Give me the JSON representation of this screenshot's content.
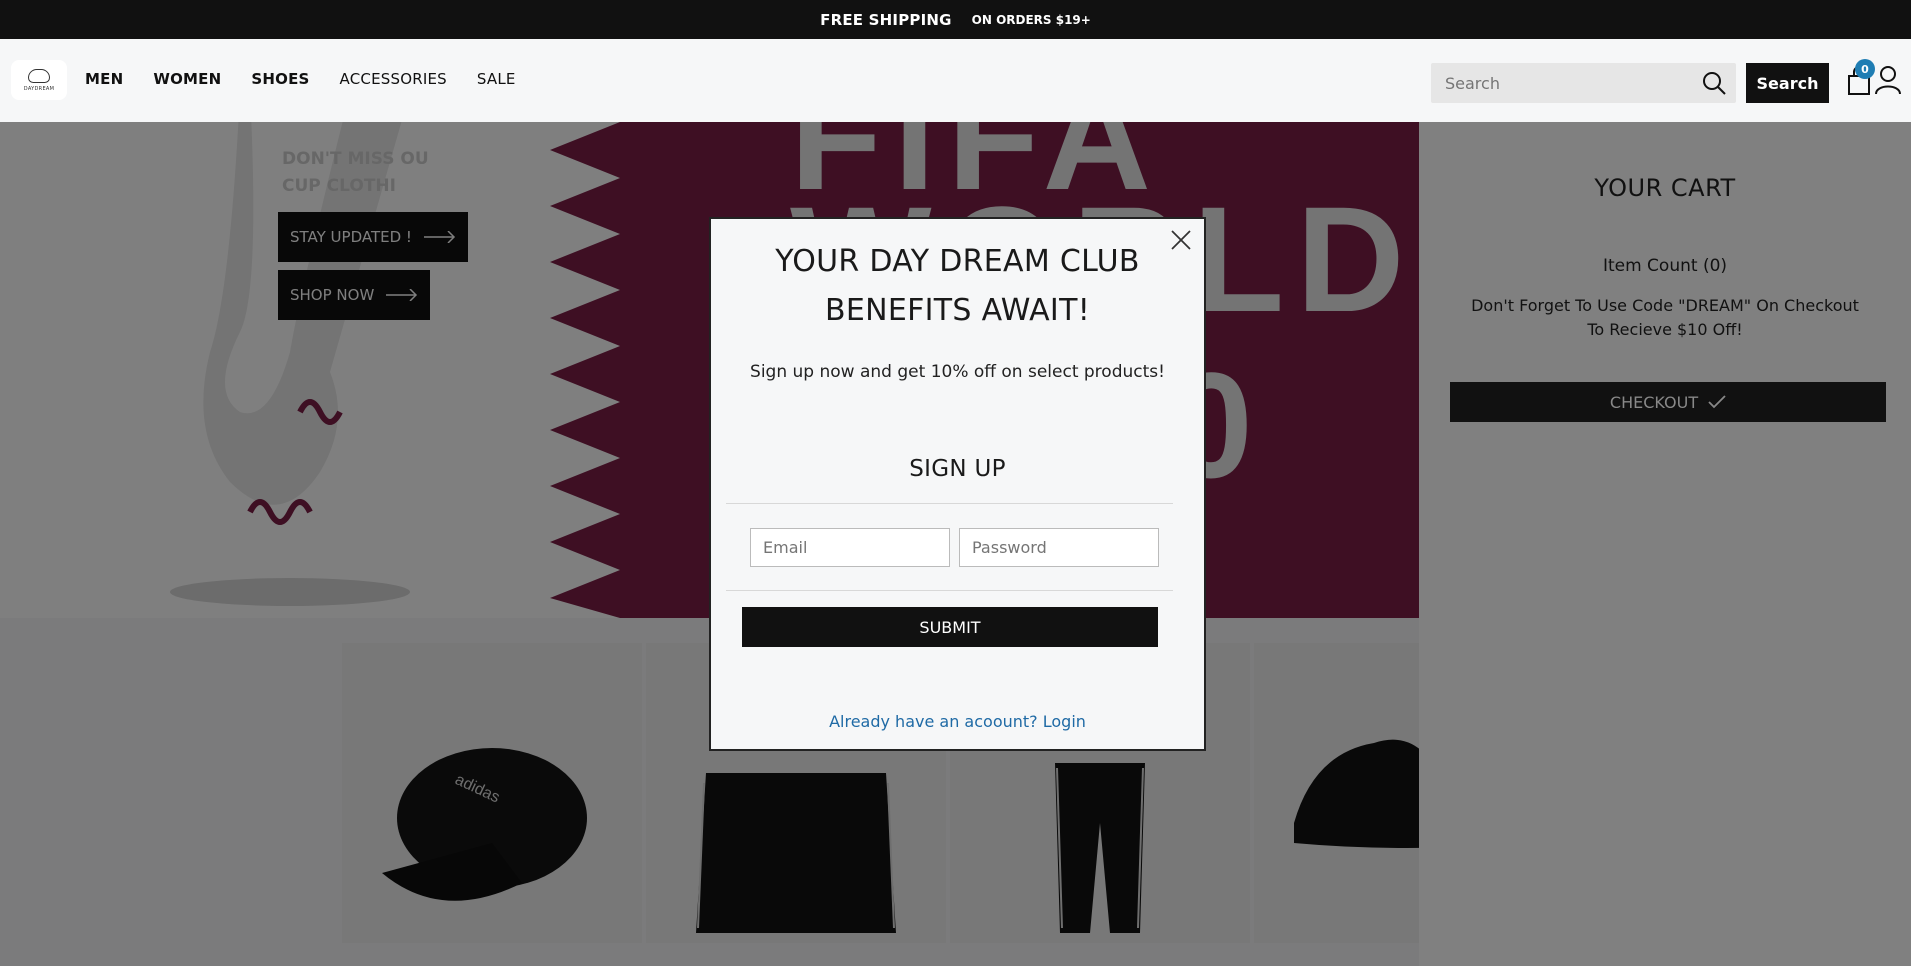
{
  "banner": {
    "bold": "FREE SHIPPING",
    "light": "ON ORDERS $19+"
  },
  "header": {
    "logo_text": "DAYDREAM",
    "nav": [
      "MEN",
      "WOMEN",
      "SHOES",
      "ACCESSORIES",
      "SALE"
    ],
    "search_placeholder": "Search",
    "search_button": "Search",
    "cart_badge": "0"
  },
  "hero": {
    "text_line1": "DON'T MISS OU",
    "text_line2": "CUP CLOTHI",
    "btn_stay": "STAY UPDATED !",
    "btn_shop": "SHOP NOW",
    "big_row1": "FIFA",
    "big_row2": "WORLD C",
    "big_row3": "R 20"
  },
  "cart": {
    "title": "YOUR CART",
    "item_count": "Item Count (0)",
    "promo": "Don't Forget To Use Code \"DREAM\" On Checkout To Recieve $10 Off!",
    "checkout": "CHECKOUT"
  },
  "modal": {
    "heading_line1": "YOUR DAY DREAM CLUB",
    "heading_line2": "BENEFITS AWAIT!",
    "subtitle": "Sign up now and get 10% off on select products!",
    "signup_title": "SIGN UP",
    "email_placeholder": "Email",
    "password_placeholder": "Password",
    "submit": "SUBMIT",
    "login_link": "Already have an acoount? Login"
  },
  "colors": {
    "accent": "#1f7db3",
    "maroon": "#7d1f47",
    "dark": "#111111"
  }
}
